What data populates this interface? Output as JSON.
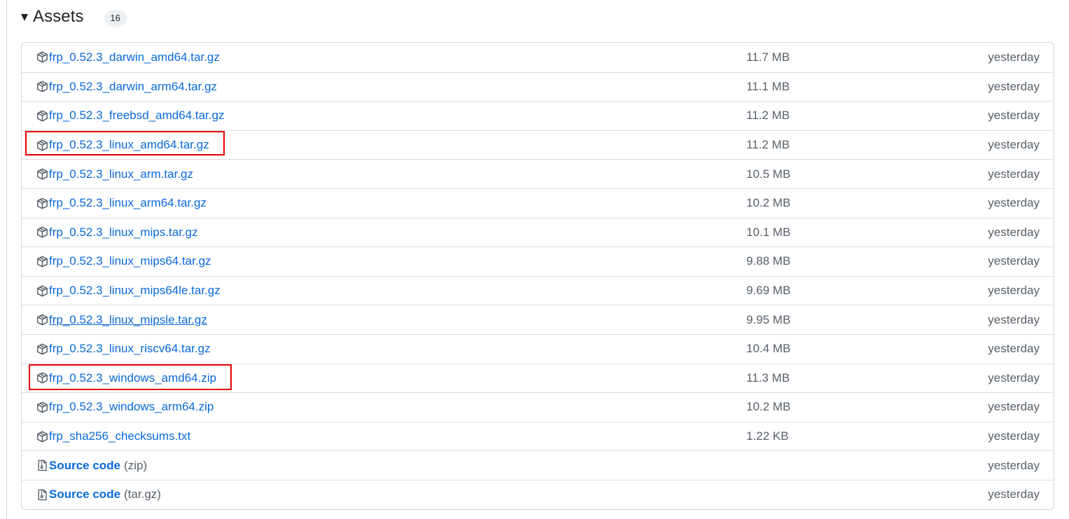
{
  "assets": {
    "title": "Assets",
    "count": "16",
    "highlight_color": "#e60000",
    "link_color": "#0969da",
    "items": [
      {
        "name": "frp_0.52.3_darwin_amd64.tar.gz",
        "size": "11.7 MB",
        "date": "yesterday",
        "icon": "package-icon"
      },
      {
        "name": "frp_0.52.3_darwin_arm64.tar.gz",
        "size": "11.1 MB",
        "date": "yesterday",
        "icon": "package-icon"
      },
      {
        "name": "frp_0.52.3_freebsd_amd64.tar.gz",
        "size": "11.2 MB",
        "date": "yesterday",
        "icon": "package-icon"
      },
      {
        "name": "frp_0.52.3_linux_amd64.tar.gz",
        "size": "11.2 MB",
        "date": "yesterday",
        "icon": "package-icon",
        "highlighted": true
      },
      {
        "name": "frp_0.52.3_linux_arm.tar.gz",
        "size": "10.5 MB",
        "date": "yesterday",
        "icon": "package-icon"
      },
      {
        "name": "frp_0.52.3_linux_arm64.tar.gz",
        "size": "10.2 MB",
        "date": "yesterday",
        "icon": "package-icon"
      },
      {
        "name": "frp_0.52.3_linux_mips.tar.gz",
        "size": "10.1 MB",
        "date": "yesterday",
        "icon": "package-icon"
      },
      {
        "name": "frp_0.52.3_linux_mips64.tar.gz",
        "size": "9.88 MB",
        "date": "yesterday",
        "icon": "package-icon"
      },
      {
        "name": "frp_0.52.3_linux_mips64le.tar.gz",
        "size": "9.69 MB",
        "date": "yesterday",
        "icon": "package-icon"
      },
      {
        "name": "frp_0.52.3_linux_mipsle.tar.gz",
        "size": "9.95 MB",
        "date": "yesterday",
        "icon": "package-icon",
        "hovered": true
      },
      {
        "name": "frp_0.52.3_linux_riscv64.tar.gz",
        "size": "10.4 MB",
        "date": "yesterday",
        "icon": "package-icon"
      },
      {
        "name": "frp_0.52.3_windows_amd64.zip",
        "size": "11.3 MB",
        "date": "yesterday",
        "icon": "package-icon",
        "highlighted": true
      },
      {
        "name": "frp_0.52.3_windows_arm64.zip",
        "size": "10.2 MB",
        "date": "yesterday",
        "icon": "package-icon"
      },
      {
        "name": "frp_sha256_checksums.txt",
        "size": "1.22 KB",
        "date": "yesterday",
        "icon": "package-icon"
      },
      {
        "name": "Source code",
        "suffix": "(zip)",
        "size": "",
        "date": "yesterday",
        "icon": "file-zip-icon"
      },
      {
        "name": "Source code",
        "suffix": "(tar.gz)",
        "size": "",
        "date": "yesterday",
        "icon": "file-zip-icon"
      }
    ]
  }
}
